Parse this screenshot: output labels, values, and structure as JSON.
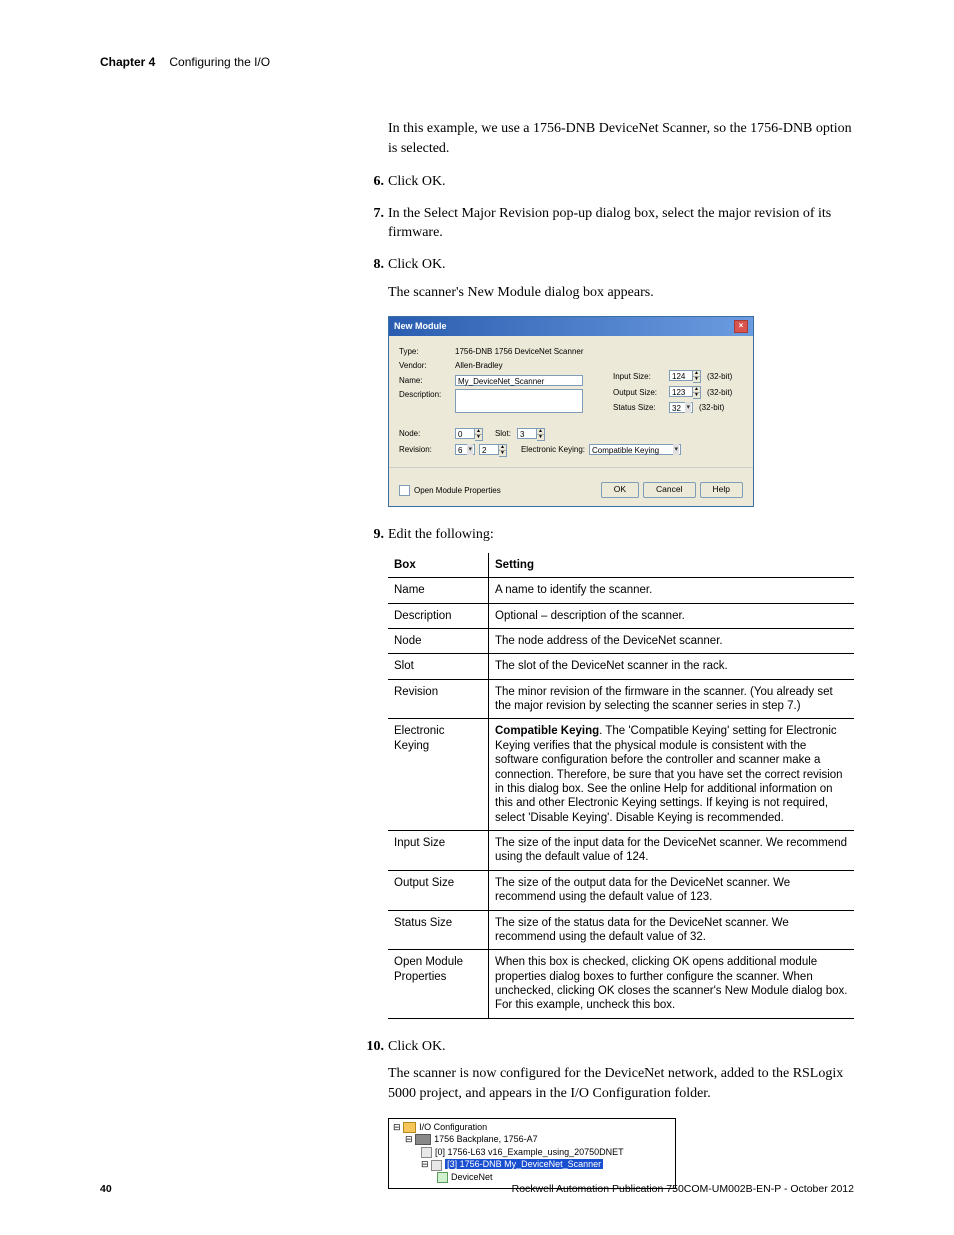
{
  "header": {
    "chapter": "Chapter 4",
    "title": "Configuring the I/O"
  },
  "intro": "In this example, we use a 1756-DNB DeviceNet Scanner, so the 1756-DNB option is selected.",
  "steps": {
    "s6": {
      "num": "6.",
      "text": "Click OK."
    },
    "s7": {
      "num": "7.",
      "text": "In the Select Major Revision pop-up dialog box, select the major revision of its firmware."
    },
    "s8": {
      "num": "8.",
      "text": "Click OK.",
      "after": "The scanner's New Module dialog box appears."
    },
    "s9": {
      "num": "9.",
      "text": "Edit the following:"
    },
    "s10": {
      "num": "10.",
      "text": "Click OK.",
      "after": "The scanner is now configured for the DeviceNet network, added to the RSLogix 5000 project, and appears in the I/O Configuration folder."
    }
  },
  "dialog": {
    "title": "New Module",
    "type_lab": "Type:",
    "type_val": "1756-DNB 1756 DeviceNet Scanner",
    "vendor_lab": "Vendor:",
    "vendor_val": "Allen-Bradley",
    "name_lab": "Name:",
    "name_val": "My_DeviceNet_Scanner",
    "desc_lab": "Description:",
    "desc_val": "",
    "input_lab": "Input Size:",
    "input_val": "124",
    "input_unit": "(32-bit)",
    "output_lab": "Output Size:",
    "output_val": "123",
    "output_unit": "(32-bit)",
    "status_lab": "Status Size:",
    "status_val": "32",
    "status_unit": "(32-bit)",
    "node_lab": "Node:",
    "node_val": "0",
    "slot_lab": "Slot:",
    "slot_val": "3",
    "rev_lab": "Revision:",
    "rev_major": "6",
    "rev_minor": "2",
    "ek_lab": "Electronic Keying:",
    "ek_val": "Compatible Keying",
    "open_mod": "Open Module Properties",
    "ok": "OK",
    "cancel": "Cancel",
    "help": "Help"
  },
  "table": {
    "h1": "Box",
    "h2": "Setting",
    "rows": [
      {
        "b": "Name",
        "s": "A name to identify the scanner."
      },
      {
        "b": "Description",
        "s": "Optional – description of the scanner."
      },
      {
        "b": "Node",
        "s": "The node address of the DeviceNet scanner."
      },
      {
        "b": "Slot",
        "s": "The slot of the DeviceNet scanner in the rack."
      },
      {
        "b": "Revision",
        "s": "The minor revision of the firmware in the scanner. (You already set the major revision by selecting the scanner series in step 7.)"
      },
      {
        "b": "Electronic Keying",
        "s": "Compatible Keying. The 'Compatible Keying' setting for Electronic Keying verifies that the physical module is consistent with the software configuration before the controller and scanner make a connection. Therefore, be sure that you have set the correct revision in this dialog box. See the online Help for additional information on this and other Electronic Keying settings. If keying is not required, select 'Disable Keying'. Disable Keying is recommended.",
        "bold_lead": "Compatible Keying"
      },
      {
        "b": "Input Size",
        "s": "The size of the input data for the DeviceNet scanner. We recommend using the default value of 124."
      },
      {
        "b": "Output Size",
        "s": "The size of the output data for the DeviceNet scanner. We recommend using the default value of 123."
      },
      {
        "b": "Status Size",
        "s": "The size of the status data for the DeviceNet scanner. We recommend using the default value of 32."
      },
      {
        "b": "Open Module Properties",
        "s": "When this box is checked, clicking OK opens additional module properties dialog boxes to further configure the scanner. When unchecked, clicking OK closes the scanner's New Module dialog box. For this example, uncheck this box."
      }
    ]
  },
  "tree": {
    "root": "I/O Configuration",
    "backplane": "1756 Backplane, 1756-A7",
    "controller": "[0] 1756-L63 v16_Example_using_20750DNET",
    "scanner": "[3] 1756-DNB My_DeviceNet_Scanner",
    "network": "DeviceNet"
  },
  "footer": {
    "page": "40",
    "pub": "Rockwell Automation Publication 750COM-UM002B-EN-P - October 2012"
  }
}
